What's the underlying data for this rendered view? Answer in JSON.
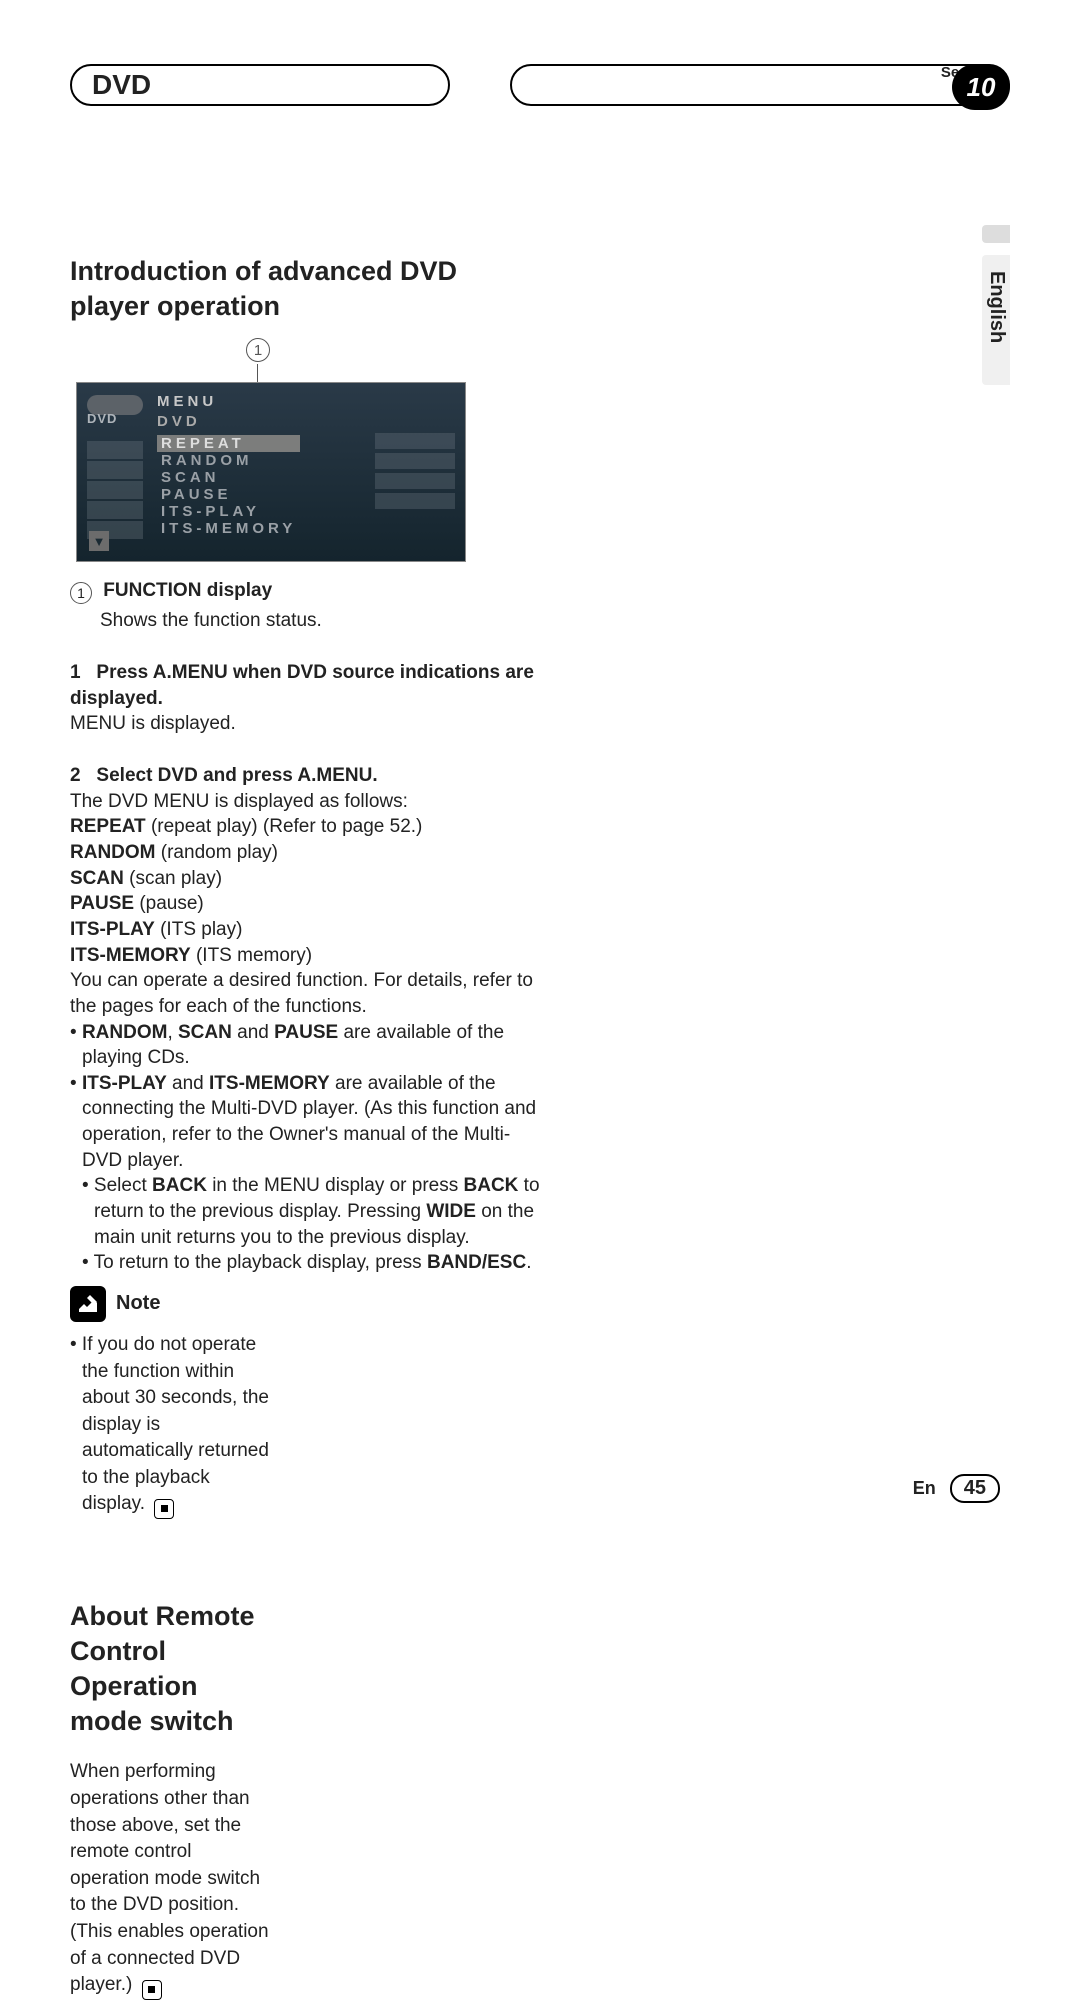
{
  "header": {
    "section_label": "Section",
    "chapter_title": "DVD",
    "section_number": "10"
  },
  "left": {
    "title": "Introduction of advanced DVD player operation",
    "callout_number": "1",
    "screen": {
      "disc_label": "DVD",
      "menu_label": "MENU",
      "submenu_label": "DVD",
      "items": [
        "REPEAT",
        "RANDOM",
        "SCAN",
        "PAUSE",
        "ITS-PLAY",
        "ITS-MEMORY"
      ],
      "selected_index": 0
    },
    "func_label_num": "1",
    "func_label": "FUNCTION display",
    "func_desc": "Shows the function status.",
    "step1_num": "1",
    "step1_text": "Press A.MENU when DVD source indications are displayed.",
    "step1_result": "MENU is displayed.",
    "step2_num": "2",
    "step2_text": "Select DVD and press A.MENU.",
    "step2_result": "The DVD MENU is displayed as follows:",
    "defs": [
      {
        "term": "REPEAT",
        "desc": " (repeat play) (Refer to page 52.)"
      },
      {
        "term": "RANDOM",
        "desc": " (random play)"
      },
      {
        "term": "SCAN",
        "desc": " (scan play)"
      },
      {
        "term": "PAUSE",
        "desc": " (pause)"
      },
      {
        "term": "ITS-PLAY",
        "desc": " (ITS play)"
      },
      {
        "term": "ITS-MEMORY",
        "desc": " (ITS memory)"
      }
    ],
    "para_operate": "You can operate a desired function. For details, refer to the pages for each of the functions.",
    "bullet1_pre": "• ",
    "bullet1_b1": "RANDOM",
    "bullet1_mid1": ", ",
    "bullet1_b2": "SCAN",
    "bullet1_mid2": " and ",
    "bullet1_b3": "PAUSE",
    "bullet1_post": " are available of the playing CDs.",
    "bullet2_pre": "• ",
    "bullet2_b1": "ITS-PLAY",
    "bullet2_mid": " and ",
    "bullet2_b2": "ITS-MEMORY",
    "bullet2_post": " are available of the connecting the Multi-DVD player. (As this function and operation, refer to the Owner's manual of the Multi-DVD player.",
    "bullet3_pre": "• Select ",
    "bullet3_b1": "BACK",
    "bullet3_mid": " in the MENU display or press ",
    "bullet3_b2": "BACK",
    "bullet3_post1": " to return to the previous display. Pressing ",
    "bullet3_b3": "WIDE",
    "bullet3_post2": " on the main unit returns you to the previous display.",
    "bullet4_pre": "• To return to the playback display, press ",
    "bullet4_b1": "BAND/ESC",
    "bullet4_post": "."
  },
  "right": {
    "note_label": "Note",
    "note_text": "• If you do not operate the function within about 30 seconds, the display is automatically returned to the playback display.",
    "sec2_title": "About Remote Control Operation mode switch",
    "sec2_body": "When performing operations other than those above, set the remote control operation mode switch to the DVD position. (This enables operation of a connected DVD player.)"
  },
  "side": {
    "language": "English"
  },
  "footer": {
    "lang_code": "En",
    "page": "45"
  }
}
